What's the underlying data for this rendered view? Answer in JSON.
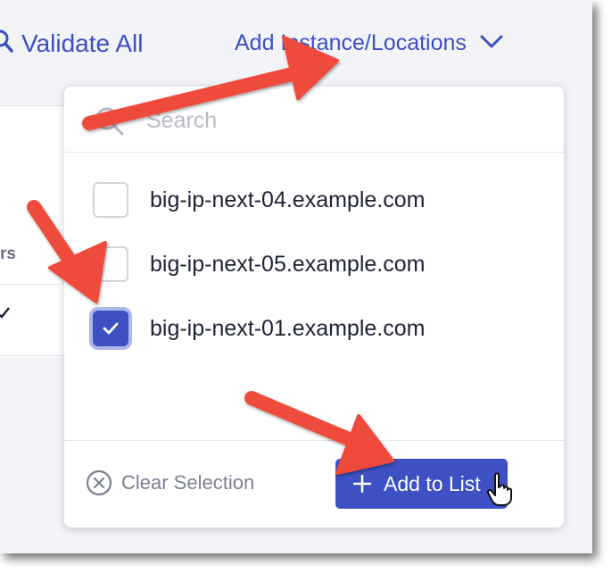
{
  "toolbar": {
    "validate_all_label": "Validate All",
    "add_instance_label": "Add Instance/Locations",
    "validate_icon": "validate-search-icon",
    "dropdown_icon": "chevron-down-icon"
  },
  "background_table": {
    "column_fragment": "rs"
  },
  "dropdown": {
    "search": {
      "placeholder": "Search",
      "value": "",
      "icon": "search-icon"
    },
    "options": [
      {
        "label": "big-ip-next-04.example.com",
        "checked": false
      },
      {
        "label": "big-ip-next-05.example.com",
        "checked": false
      },
      {
        "label": "big-ip-next-01.example.com",
        "checked": true
      }
    ],
    "footer": {
      "clear_selection_label": "Clear Selection",
      "clear_icon": "circle-x-icon",
      "add_to_list_label": "Add to List",
      "add_icon": "plus-icon"
    }
  },
  "colors": {
    "accent": "#3d51c5",
    "link": "#3b4fc4",
    "annotation_arrow": "#ef4b3c",
    "text_primary": "#1e2238",
    "text_muted": "#7c8092"
  }
}
